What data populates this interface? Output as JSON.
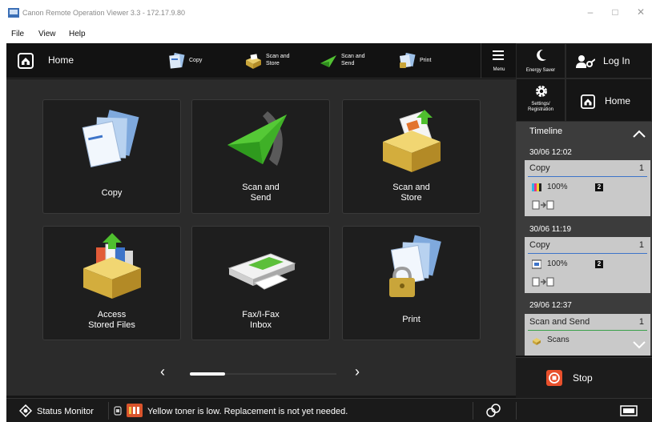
{
  "window": {
    "title": "Canon Remote Operation Viewer 3.3 - 172.17.9.80",
    "menu": [
      "File",
      "View",
      "Help"
    ]
  },
  "topbar": {
    "home_label": "Home",
    "shortcuts": [
      {
        "label": "Copy",
        "icon": "copy-icon"
      },
      {
        "label": "Scan and\nStore",
        "icon": "scan-and-store-icon"
      },
      {
        "label": "Scan and\nSend",
        "icon": "scan-and-send-icon"
      },
      {
        "label": "Print",
        "icon": "print-icon"
      }
    ],
    "menu_label": "Menu"
  },
  "tiles": [
    {
      "label": "Copy",
      "icon": "copy-icon"
    },
    {
      "label": "Scan and\nSend",
      "icon": "paper-plane-icon"
    },
    {
      "label": "Scan and\nStore",
      "icon": "scan-to-box-icon"
    },
    {
      "label": "Access\nStored Files",
      "icon": "stored-files-icon"
    },
    {
      "label": "Fax/I-Fax\nInbox",
      "icon": "fax-inbox-icon"
    },
    {
      "label": "Print",
      "icon": "secure-print-icon"
    }
  ],
  "right_panel": {
    "energy_saver_label": "Energy Saver",
    "login_label": "Log In",
    "settings_label": "Settings/\nRegistration",
    "home_label": "Home",
    "stop_label": "Stop"
  },
  "timeline": {
    "title": "Timeline",
    "entries": [
      {
        "time": "30/06 12:02",
        "job": "Copy",
        "count": "1",
        "percent": "100%",
        "badge": "2",
        "line_color": "#3d74c9"
      },
      {
        "time": "30/06 11:19",
        "job": "Copy",
        "count": "1",
        "percent": "100%",
        "badge": "2",
        "line_color": "#3d74c9"
      },
      {
        "time": "29/06 12:37",
        "job": "Scan and Send",
        "count": "1",
        "detail": "Scans",
        "line_color": "#3aa04a"
      }
    ]
  },
  "status_bar": {
    "monitor_label": "Status Monitor",
    "message": "Yellow toner is low. Replacement is not yet needed."
  }
}
